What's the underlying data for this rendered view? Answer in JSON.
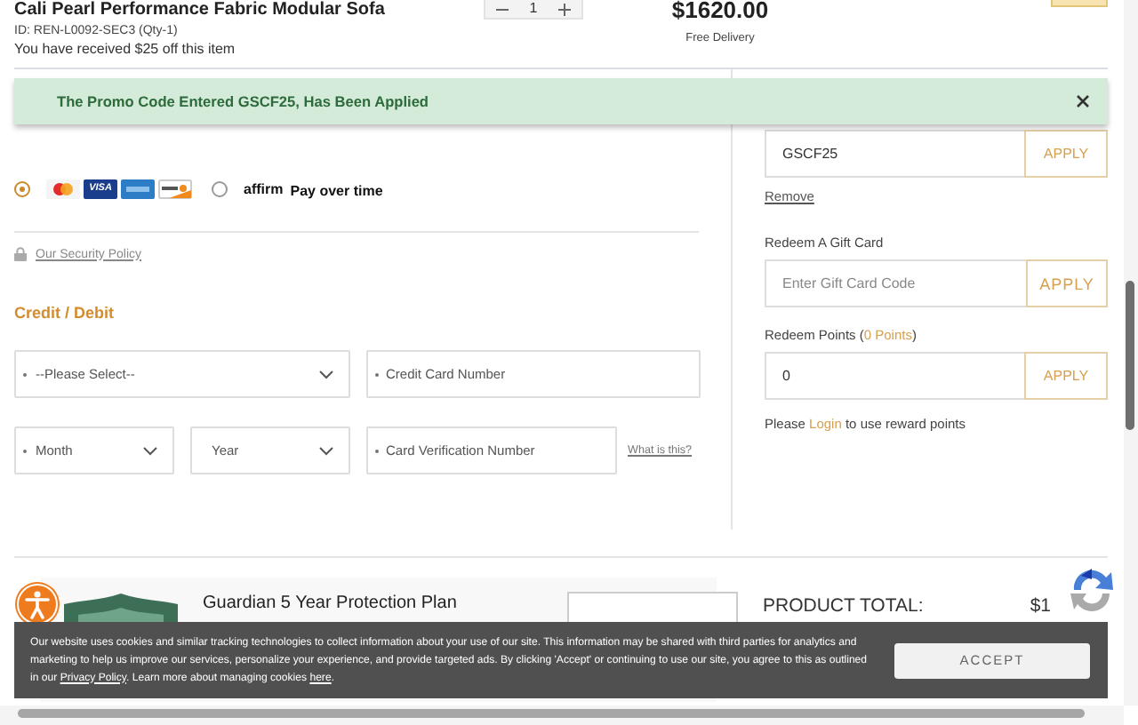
{
  "product": {
    "title": "Cali Pearl Performance Fabric Modular Sofa",
    "id_line": "ID: REN-L0092-SEC3 (Qty-1)",
    "discount": "You have received $25 off this item",
    "quantity": "1",
    "price": "$1620.00",
    "delivery": "Free Delivery"
  },
  "promo_banner": {
    "message": "The Promo Code Entered GSCF25, Has Been Applied"
  },
  "payment": {
    "options": [
      {
        "kind": "cards",
        "selected": true,
        "cards": [
          {
            "kind": "mastercard"
          },
          {
            "kind": "visa",
            "label": "VISA"
          },
          {
            "kind": "amex"
          },
          {
            "kind": "discover"
          }
        ]
      },
      {
        "kind": "affirm",
        "selected": false,
        "logo": "affirm",
        "label": "Pay over time"
      }
    ],
    "security_link": "Our Security Policy",
    "section_title": "Credit / Debit",
    "fields": [
      {
        "kind": "select",
        "placeholder": "--Please Select--",
        "required": true
      },
      {
        "kind": "input",
        "placeholder": "Credit Card Number",
        "required": true
      },
      {
        "kind": "select",
        "placeholder": "Month",
        "required": true
      },
      {
        "kind": "select",
        "placeholder": "Year",
        "required": false
      },
      {
        "kind": "input",
        "placeholder": "Card Verification Number",
        "required": true
      }
    ],
    "help_link": "What is this?"
  },
  "side": {
    "promo": {
      "value": "GSCF25",
      "button": "APPLY",
      "remove": "Remove"
    },
    "gift_card": {
      "label": "Redeem A Gift Card",
      "placeholder": "Enter Gift Card Code",
      "button": "APPLY"
    },
    "points": {
      "label": "Redeem Points (",
      "points": "0 Points",
      "label_end": ")",
      "value": "0",
      "button": "APPLY"
    },
    "login_note": {
      "before": "Please",
      "link": "Login",
      "after": "to use reward points"
    }
  },
  "protection_plan": {
    "title": "Guardian 5 Year Protection Plan"
  },
  "total": {
    "label": "PRODUCT TOTAL:",
    "value": "$1"
  },
  "cookie": {
    "text": "Our website uses cookies and similar tracking technologies to collect information about your use of our site. This information may be shared with third parties for analytics and marketing to help us improve our services, personalize your experience, and provide targeted ads. By clicking 'Accept' or continuing to use our site, you agree to this as outlined in our",
    "privacy_link": "Privacy Policy",
    "middle": ". Learn more about managing cookies",
    "here_link": "here",
    "end": ".",
    "accept": "ACCEPT"
  }
}
